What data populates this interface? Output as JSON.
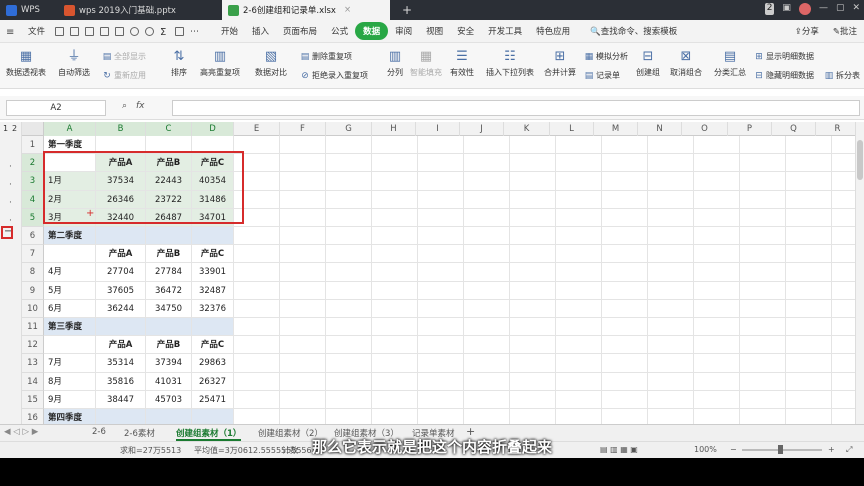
{
  "titlebar": {
    "tabs": [
      {
        "label": "WPS",
        "color": "#2f6dd8"
      },
      {
        "label": "wps 2019入门基础.pptx",
        "color": "#d8552f"
      },
      {
        "label": "2-6创建组和记录单.xlsx",
        "color": "#3aa04a"
      }
    ],
    "add": "+",
    "badge": "2"
  },
  "menubar": {
    "file": "文件",
    "items": [
      "开始",
      "插入",
      "页面布局",
      "公式",
      "数据",
      "审阅",
      "视图",
      "安全",
      "开发工具",
      "特色应用"
    ],
    "search": "查找命令、搜索模板",
    "share": "分享",
    "comment": "批注"
  },
  "ribbon": {
    "pivot": "数据透视表",
    "autofilter": "自动筛选",
    "all_show": "全部显示",
    "reapply": "重新应用",
    "sort": "排序",
    "highlight_dup": "高亮重复项",
    "compare": "数据对比",
    "delete_dup": "删除重复项",
    "reject_dup": "拒绝录入重复项",
    "split": "分列",
    "smart_fill": "智能填充",
    "validity": "有效性",
    "dropdown": "插入下拉列表",
    "consolidate": "合并计算",
    "simulate": "模拟分析",
    "record": "记录单",
    "create_group": "创建组",
    "ungroup": "取消组合",
    "subtotal": "分类汇总",
    "show_detail": "显示明细数据",
    "hide_detail": "隐藏明细数据",
    "split_table": "拆分表"
  },
  "formula": {
    "namebox": "A2",
    "fx": "fx"
  },
  "columns": [
    "A",
    "B",
    "C",
    "D",
    "E",
    "F",
    "G",
    "H",
    "I",
    "J",
    "K",
    "L",
    "M",
    "N",
    "O",
    "P",
    "Q",
    "R"
  ],
  "outline_levels": [
    "1",
    "2"
  ],
  "rows": [
    {
      "n": "1",
      "a": "第一季度",
      "b": "",
      "c": "",
      "d": ""
    },
    {
      "n": "2",
      "a": "",
      "b": "产品A",
      "c": "产品B",
      "d": "产品C"
    },
    {
      "n": "3",
      "a": "1月",
      "b": "37534",
      "c": "22443",
      "d": "40354"
    },
    {
      "n": "4",
      "a": "2月",
      "b": "26346",
      "c": "23722",
      "d": "31486"
    },
    {
      "n": "5",
      "a": "3月",
      "b": "32440",
      "c": "26487",
      "d": "34701"
    },
    {
      "n": "6",
      "a": "第二季度",
      "b": "",
      "c": "",
      "d": ""
    },
    {
      "n": "7",
      "a": "",
      "b": "产品A",
      "c": "产品B",
      "d": "产品C"
    },
    {
      "n": "8",
      "a": "4月",
      "b": "27704",
      "c": "27784",
      "d": "33901"
    },
    {
      "n": "9",
      "a": "5月",
      "b": "37605",
      "c": "36472",
      "d": "32487"
    },
    {
      "n": "10",
      "a": "6月",
      "b": "36244",
      "c": "34750",
      "d": "32376"
    },
    {
      "n": "11",
      "a": "第三季度",
      "b": "",
      "c": "",
      "d": ""
    },
    {
      "n": "12",
      "a": "",
      "b": "产品A",
      "c": "产品B",
      "d": "产品C"
    },
    {
      "n": "13",
      "a": "7月",
      "b": "35314",
      "c": "37394",
      "d": "29863"
    },
    {
      "n": "14",
      "a": "8月",
      "b": "35816",
      "c": "41031",
      "d": "26327"
    },
    {
      "n": "15",
      "a": "9月",
      "b": "38447",
      "c": "45703",
      "d": "25471"
    },
    {
      "n": "16",
      "a": "第四季度",
      "b": "",
      "c": "",
      "d": ""
    }
  ],
  "sheets": [
    "2-6",
    "2-6素材",
    "创建组素材（1）",
    "创建组素材（2）",
    "创建组素材（3）",
    "记录单素材"
  ],
  "sheet_add": "+",
  "status": {
    "sum": "求和=27万5513",
    "avg": "平均值=3万0612.5555555556",
    "count": "计数",
    "zoom": "100%"
  },
  "subtitle": "那么它表示就是把这个内容折叠起来",
  "colors": {
    "accent": "#28a745",
    "highlight": "#d62b2b"
  }
}
